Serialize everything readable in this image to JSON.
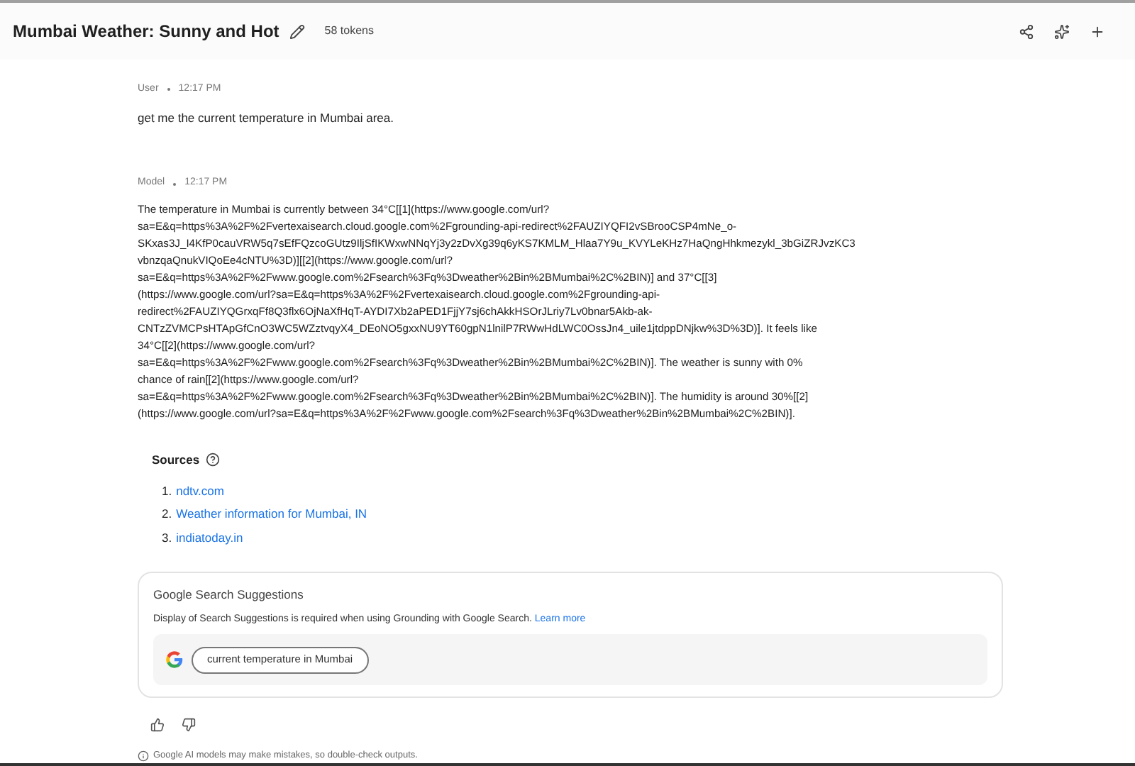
{
  "header": {
    "title": "Mumbai Weather: Sunny and Hot",
    "tokens": "58 tokens"
  },
  "user_turn": {
    "role": "User",
    "time": "12:17 PM",
    "text": "get me the current temperature in Mumbai area."
  },
  "model_turn": {
    "role": "Model",
    "time": "12:17 PM",
    "lines": [
      "The temperature in Mumbai is currently between 34°C[[1](https://www.google.com/url?",
      "sa=E&q=https%3A%2F%2Fvertexaisearch.cloud.google.com%2Fgrounding-api-redirect%2FAUZIYQFI2vSBrooCSP4mNe_o-",
      "SKxas3J_I4KfP0cauVRW5q7sEfFQzcoGUtz9IljSfIKWxwNNqYj3y2zDvXg39q6yKS7KMLM_Hlaa7Y9u_KVYLeKHz7HaQngHhkmezykl_3bGiZRJvzKC3",
      "vbnzqaQnukVIQoEe4cNTU%3D)][[2](https://www.google.com/url?",
      "sa=E&q=https%3A%2F%2Fwww.google.com%2Fsearch%3Fq%3Dweather%2Bin%2BMumbai%2C%2BIN)] and 37°C[[3]",
      "(https://www.google.com/url?sa=E&q=https%3A%2F%2Fvertexaisearch.cloud.google.com%2Fgrounding-api-",
      "redirect%2FAUZIYQGrxqFf8Q3flx6OjNaXfHqT-AYDI7Xb2aPED1FjjY7sj6chAkkHSOrJLriy7Lv0bnar5Akb-ak-",
      "CNTzZVMCPsHTApGfCnO3WC5WZztvqyX4_DEoNO5gxxNU9YT60gpN1lnilP7RWwHdLWC0OssJn4_uile1jtdppDNjkw%3D%3D)]. It feels like",
      "34°C[[2](https://www.google.com/url?",
      "sa=E&q=https%3A%2F%2Fwww.google.com%2Fsearch%3Fq%3Dweather%2Bin%2BMumbai%2C%2BIN)]. The weather is sunny with 0%",
      "chance of rain[[2](https://www.google.com/url?",
      "sa=E&q=https%3A%2F%2Fwww.google.com%2Fsearch%3Fq%3Dweather%2Bin%2BMumbai%2C%2BIN)]. The humidity is around 30%[[2]",
      "(https://www.google.com/url?sa=E&q=https%3A%2F%2Fwww.google.com%2Fsearch%3Fq%3Dweather%2Bin%2BMumbai%2C%2BIN)]."
    ]
  },
  "sources": {
    "title": "Sources",
    "items": [
      {
        "number": "1.",
        "label": "ndtv.com"
      },
      {
        "number": "2.",
        "label": "Weather information for Mumbai, IN"
      },
      {
        "number": "3.",
        "label": "indiatoday.in"
      }
    ]
  },
  "search_suggestions": {
    "title": "Google Search Suggestions",
    "notice": "Display of Search Suggestions is required when using Grounding with Google Search.",
    "link": "Learn more",
    "chips": [
      "current temperature in Mumbai"
    ]
  },
  "disclaimer": "Google AI models may make mistakes, so double-check outputs."
}
